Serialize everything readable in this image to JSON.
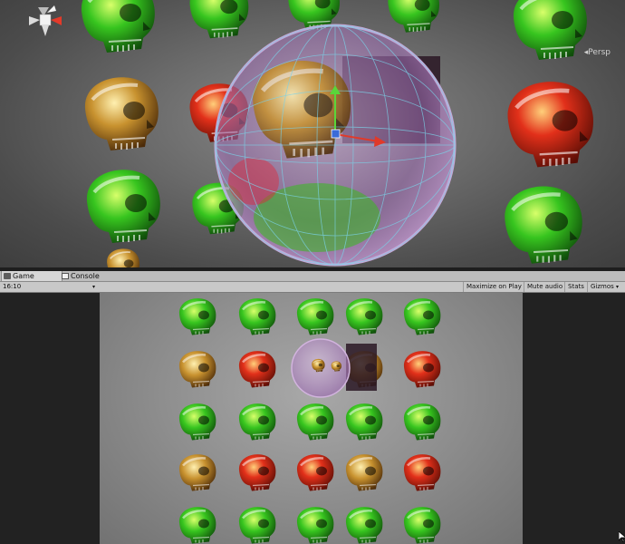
{
  "scene_view": {
    "projection_label": "◂Persp",
    "gizmo_axes": [
      "x",
      "y",
      "z"
    ]
  },
  "tabs": [
    {
      "label": "Game",
      "icon": "game-controller-icon",
      "active": true
    },
    {
      "label": "Console",
      "icon": "console-icon",
      "active": false
    }
  ],
  "toolbar": {
    "aspect_ratio": "16:10",
    "maximize_label": "Maximize on Play",
    "mute_label": "Mute audio",
    "stats_label": "Stats",
    "gizmos_label": "Gizmos"
  },
  "game_view": {
    "grid_rows": 5,
    "grid_cols": 5,
    "skull_colors": [
      "#2fbf1f",
      "#d4a33a",
      "#e0281a"
    ]
  }
}
